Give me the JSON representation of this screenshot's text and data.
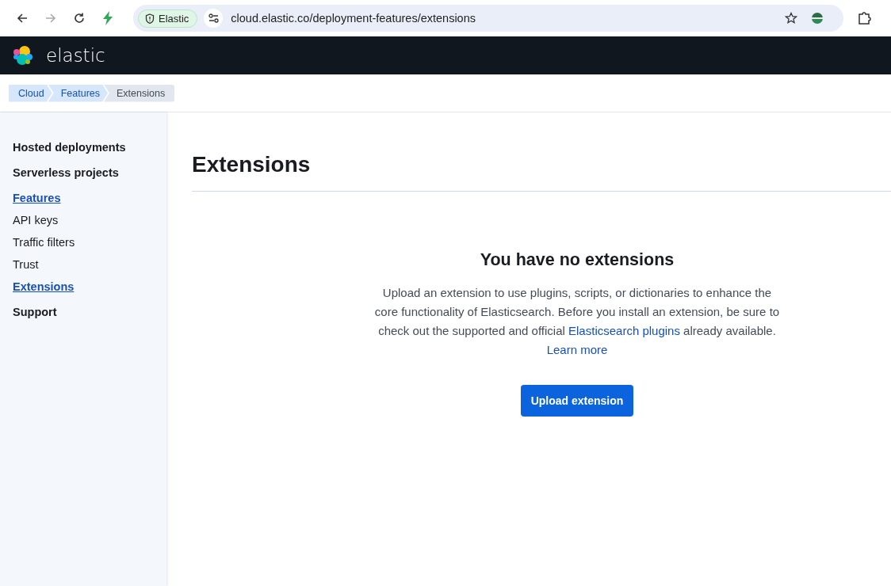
{
  "browser": {
    "site_chip": "Elastic",
    "url": "cloud.elastic.co/deployment-features/extensions",
    "forward_disabled": true
  },
  "header": {
    "brand": "elastic"
  },
  "breadcrumbs": [
    {
      "label": "Cloud",
      "selected": false
    },
    {
      "label": "Features",
      "selected": false
    },
    {
      "label": "Extensions",
      "selected": true
    }
  ],
  "sidebar": {
    "sections": [
      {
        "label": "Hosted deployments",
        "selected": false
      },
      {
        "label": "Serverless projects",
        "selected": false
      },
      {
        "label": "Features",
        "selected": true,
        "children": [
          {
            "label": "API keys",
            "selected": false
          },
          {
            "label": "Traffic filters",
            "selected": false
          },
          {
            "label": "Trust",
            "selected": false
          },
          {
            "label": "Extensions",
            "selected": true
          }
        ]
      },
      {
        "label": "Support",
        "selected": false
      }
    ]
  },
  "page": {
    "title": "Extensions",
    "empty_state": {
      "title": "You have no extensions",
      "description": [
        {
          "kind": "text",
          "text": "Upload an extension to use plugins, scripts, or dictionaries to enhance the core functionality of Elasticsearch. Before you install an extension, be sure to check out the supported and official "
        },
        {
          "kind": "link",
          "text": "Elasticsearch plugins"
        },
        {
          "kind": "text",
          "text": " already available. "
        },
        {
          "kind": "link",
          "text": "Learn more"
        }
      ],
      "button": "Upload extension"
    }
  }
}
